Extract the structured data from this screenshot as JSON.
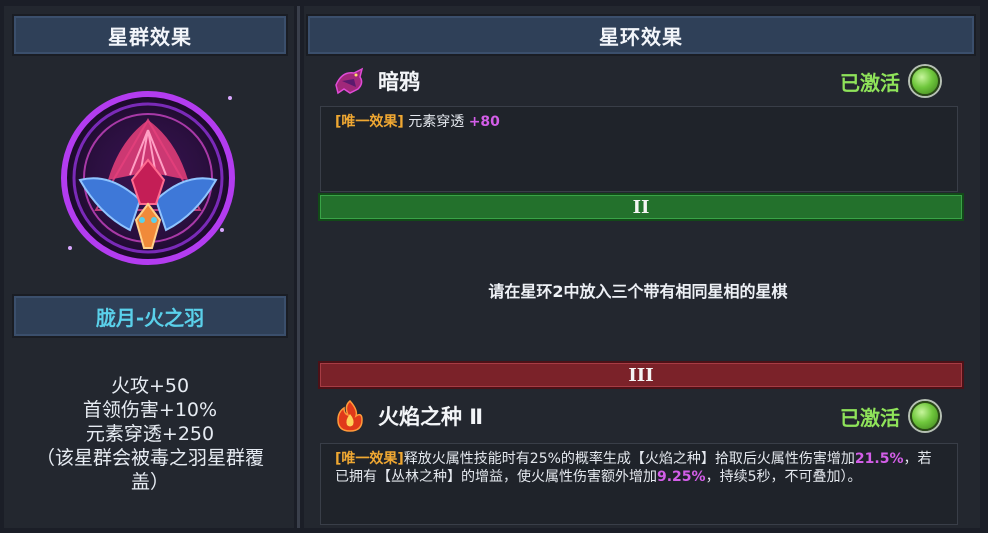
{
  "left_panel": {
    "header": "星群效果",
    "constellation_name": "胧月-火之羽",
    "stats": [
      "火攻+50",
      "首领伤害+10%",
      "元素穿透+250",
      "（该星群会被毒之羽星群覆",
      "盖）"
    ]
  },
  "right_panel": {
    "header": "星环效果",
    "ring1": {
      "title": "暗鸦",
      "icon": "dark-crow-icon",
      "status": "已激活",
      "effect_tag": "[唯一效果]",
      "effect_text": "元素穿透",
      "effect_value": "+80"
    },
    "ring2": {
      "numeral": "II",
      "requirement": "请在星环2中放入三个带有相同星相的星棋"
    },
    "ring3": {
      "numeral": "III",
      "title": "火焰之种 Ⅱ",
      "icon": "flame-seed-icon",
      "status": "已激活",
      "effect_tag": "[唯一效果]",
      "effect_part1": "释放火属性技能时有25%的概率生成【火焰之种】拾取后火属性伤害增加",
      "effect_value1": "21.5%",
      "effect_part2": "，若已拥有【丛林之种】的增益，使火属性伤害额外增加",
      "effect_value2": "9.25%",
      "effect_part3": "，持续5秒，不可叠加）。"
    }
  },
  "colors": {
    "active_green": "#8fe35a",
    "tag_orange": "#f0a832",
    "value_purple": "#d35ee8",
    "name_cyan": "#5ad0ea",
    "ring2_bar": "#23712c",
    "ring3_bar": "#7b2229"
  }
}
